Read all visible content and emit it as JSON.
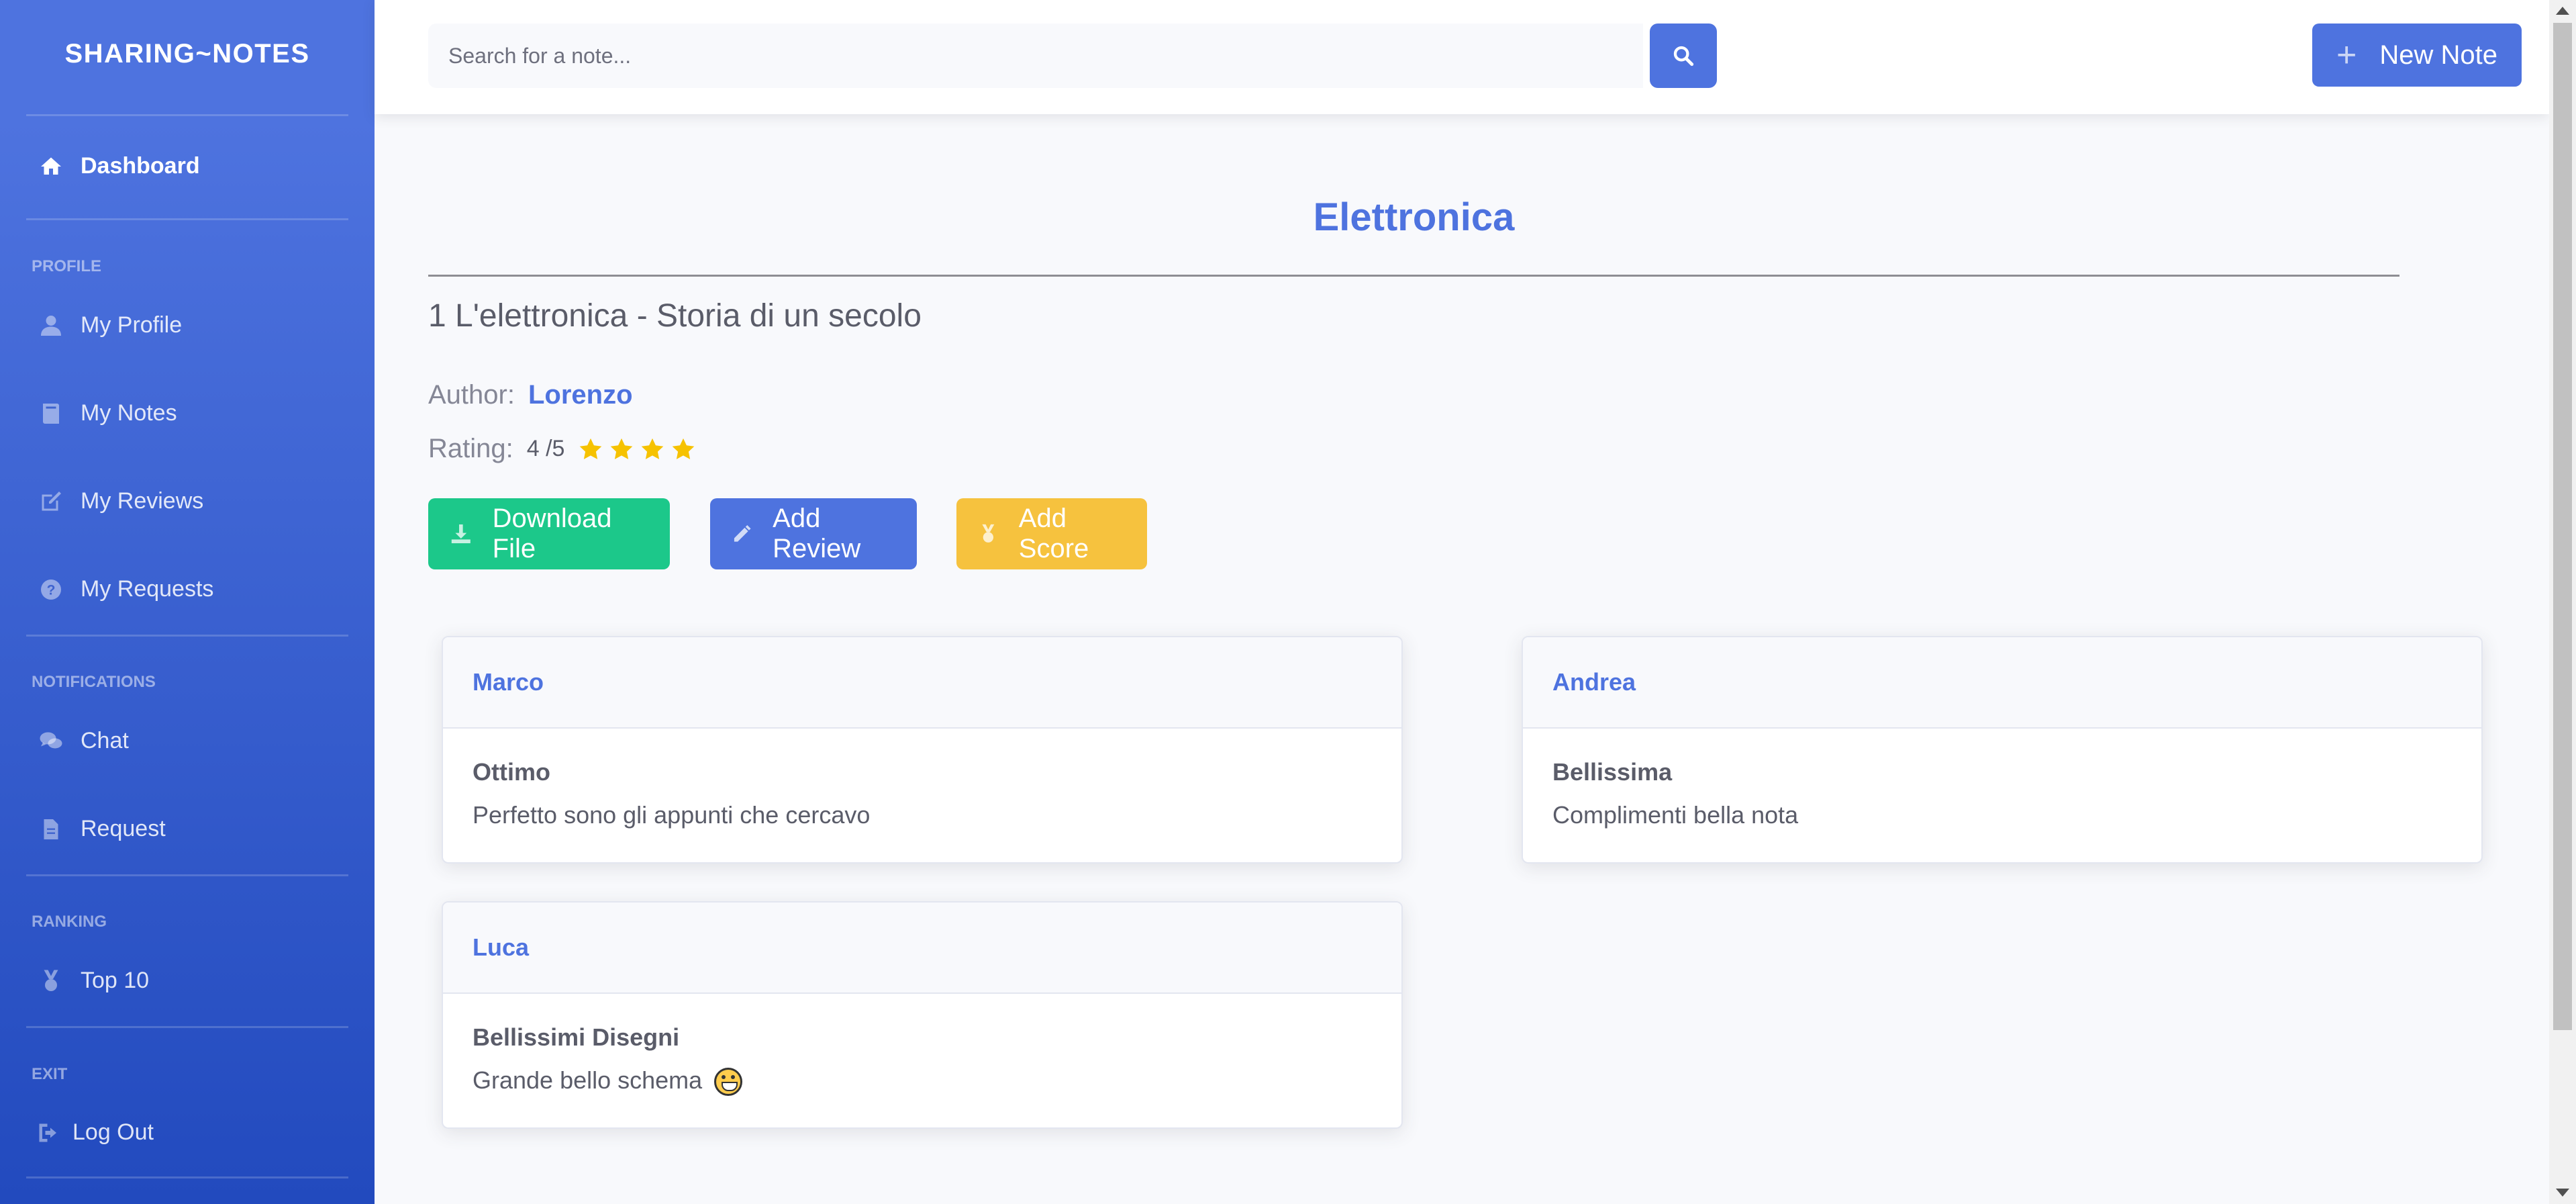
{
  "brand": "SHARING~NOTES",
  "sidebar": {
    "dashboard": {
      "label": "Dashboard",
      "icon": "home-icon"
    },
    "sections": {
      "profile": "PROFILE",
      "notifications": "NOTIFICATIONS",
      "ranking": "RANKING",
      "exit": "EXIT"
    },
    "items": {
      "my_profile": {
        "label": "My Profile",
        "icon": "user-icon"
      },
      "my_notes": {
        "label": "My Notes",
        "icon": "book-icon"
      },
      "my_reviews": {
        "label": "My Reviews",
        "icon": "edit-icon"
      },
      "my_requests": {
        "label": "My Requests",
        "icon": "question-circle-icon"
      },
      "chat": {
        "label": "Chat",
        "icon": "comments-icon"
      },
      "request": {
        "label": "Request",
        "icon": "file-icon"
      },
      "top10": {
        "label": "Top 10",
        "icon": "medal-icon"
      },
      "logout": {
        "label": "Log Out",
        "icon": "sign-out-icon"
      }
    }
  },
  "topbar": {
    "search_placeholder": "Search for a note...",
    "new_note_label": "New Note"
  },
  "page": {
    "title": "Elettronica",
    "note_title": "1 L'elettronica - Storia di un secolo",
    "author_label": "Author:",
    "author_name": "Lorenzo",
    "rating_label": "Rating:",
    "rating_value": "4 /5",
    "rating_stars": 4
  },
  "actions": {
    "download": "Download File",
    "add_review": "Add Review",
    "add_score": "Add Score"
  },
  "reviews": [
    {
      "author": "Marco",
      "title": "Ottimo",
      "text": "Perfetto sono gli appunti che cercavo"
    },
    {
      "author": "Andrea",
      "title": "Bellissima",
      "text": "Complimenti bella nota"
    },
    {
      "author": "Luca",
      "title": "Bellissimi Disegni",
      "text": "Grande bello schema"
    }
  ],
  "colors": {
    "primary": "#4e73df",
    "success": "#1cc88a",
    "warning": "#f6c23e",
    "star": "#f6c200"
  }
}
